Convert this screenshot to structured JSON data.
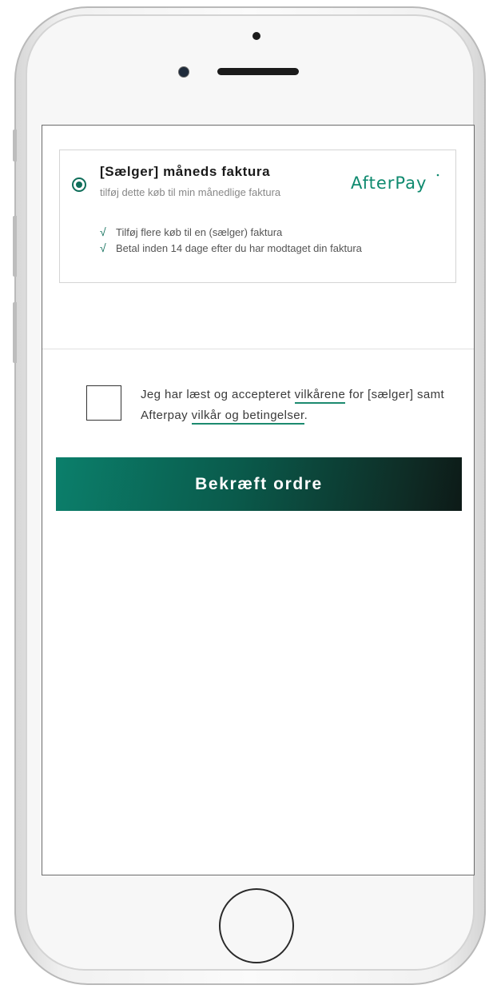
{
  "payment_option": {
    "title": "[Sælger] måneds faktura",
    "subtitle": "tilføj dette køb til min månedlige faktura",
    "selected": true,
    "brand_logo_text": "AfterPay",
    "benefits": [
      {
        "icon": "check-icon",
        "text": "Tilføj flere køb til en (sælger) faktura"
      },
      {
        "icon": "check-icon",
        "text": "Betal inden 14 dage efter du har modtaget din faktura"
      }
    ]
  },
  "terms": {
    "checked": false,
    "text_before": "Jeg har læst og accepteret ",
    "link1": "vilkårene",
    "text_middle": " for [sælger] samt Afterpay ",
    "link2": "vilkår og betingelser",
    "text_after": "."
  },
  "confirm_button": {
    "label": "Bekræft ordre"
  },
  "colors": {
    "accent": "#0f6e5a",
    "button_start": "#0b7f6b",
    "button_end": "#0d1a17",
    "link_underline": "#1c8a6f",
    "logo": "#0f8a6f"
  }
}
